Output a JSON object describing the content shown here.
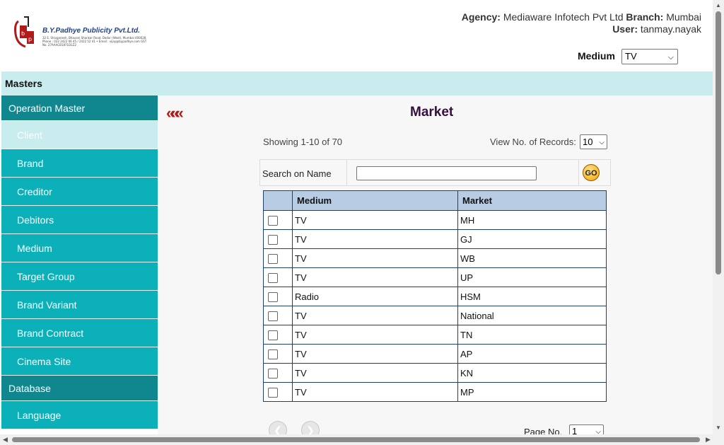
{
  "header": {
    "company_name": "B.Y.Padhye Publicity Pvt.Ltd.",
    "company_address": "32 E, Shivganesh, Bhavani Shankar Road, Dadar (West), Mumbai 400028. Phone : 022 2422 06 45 / 2422 52 41 • Email : vijay@bypadhye.com GST No. 27AAACB1871D1Z2",
    "agency_label": "Agency:",
    "agency_value": "Mediaware Infotech Pvt Ltd",
    "branch_label": "Branch:",
    "branch_value": "Mumbai",
    "user_label": "User:",
    "user_value": "tanmay.nayak",
    "medium_label": "Medium",
    "medium_value": "TV"
  },
  "masters_bar": {
    "label": "Masters"
  },
  "sidebar": {
    "sections": [
      {
        "title": "Operation Master",
        "items": [
          "Client",
          "Brand",
          "Creditor",
          "Debitors",
          "Medium",
          "Target Group",
          "Brand Variant",
          "Brand Contract",
          "Cinema Site"
        ]
      },
      {
        "title": "Database",
        "items": [
          "Language"
        ]
      }
    ],
    "active_item": "Client"
  },
  "main": {
    "back_icon": "«««",
    "title": "Market",
    "showing": "Showing 1-10 of 70",
    "view_records_label": "View No. of Records:",
    "view_records_value": "10",
    "search_label": "Search on Name",
    "search_value": "",
    "go_label": "GO",
    "columns": [
      "Medium",
      "Market"
    ],
    "rows": [
      {
        "medium": "TV",
        "market": "MH"
      },
      {
        "medium": "TV",
        "market": "GJ"
      },
      {
        "medium": "TV",
        "market": "WB"
      },
      {
        "medium": "TV",
        "market": "UP"
      },
      {
        "medium": "Radio",
        "market": "HSM"
      },
      {
        "medium": "TV",
        "market": "National"
      },
      {
        "medium": "TV",
        "market": "TN"
      },
      {
        "medium": "TV",
        "market": "AP"
      },
      {
        "medium": "TV",
        "market": "KN"
      },
      {
        "medium": "TV",
        "market": "MP"
      }
    ],
    "page_no_label": "Page No.",
    "page_no_value": "1"
  },
  "colors": {
    "sidebar_head": "#10878f",
    "sidebar_item": "#0bb0b8",
    "masters_bar": "#c9ecef",
    "title": "#33103f",
    "table_header": "#b8cce4"
  }
}
